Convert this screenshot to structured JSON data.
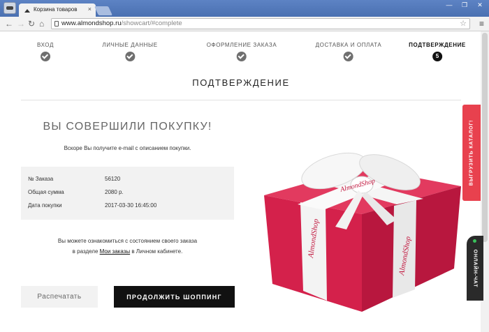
{
  "browser": {
    "tab_title": "Корзина товаров",
    "tab_close": "×",
    "url_domain": "www.almondshop.ru",
    "url_path": "/showcart/#complete",
    "win_min": "—",
    "win_max": "❐",
    "win_close": "✕",
    "menu": "≡"
  },
  "steps": [
    {
      "label": "ВХОД",
      "state": "done"
    },
    {
      "label": "ЛИЧНЫЕ ДАННЫЕ",
      "state": "done"
    },
    {
      "label": "ОФОРМЛЕНИЕ ЗАКАЗА",
      "state": "done"
    },
    {
      "label": "ДОСТАВКА И ОПЛАТА",
      "state": "done"
    },
    {
      "label": "ПОДТВЕРЖДЕНИЕ",
      "state": "active",
      "number": "5"
    }
  ],
  "page": {
    "title": "ПОДТВЕРЖДЕНИЕ",
    "headline": "ВЫ СОВЕРШИЛИ ПОКУПКУ!",
    "subtext": "Вскоре Вы получите e-mail с описанием покупки."
  },
  "order": {
    "number_label": "№ Заказа",
    "number_value": "56120",
    "total_label": "Общая сумма",
    "total_value": "2080 р.",
    "date_label": "Дата покупки",
    "date_value": "2017-03-30 16:45:00"
  },
  "note": {
    "line1": "Вы можете ознакомиться с состоянием своего заказа",
    "line2_prefix": "в разделе ",
    "link": "Мои заказы",
    "line2_suffix": " в Личном кабинете."
  },
  "buttons": {
    "print": "Распечатать",
    "continue": "ПРОДОЛЖИТЬ ШОППИНГ"
  },
  "side_tabs": {
    "catalog": "ВЫГРУЗИТЬ КАТАЛОГ!",
    "chat": "ОНЛАЙН-ЧАТ"
  },
  "gift": {
    "ribbon_text": "AlmondShop"
  },
  "colors": {
    "accent_red": "#e8414e",
    "dark": "#111111",
    "gift_red": "#d9224c"
  }
}
